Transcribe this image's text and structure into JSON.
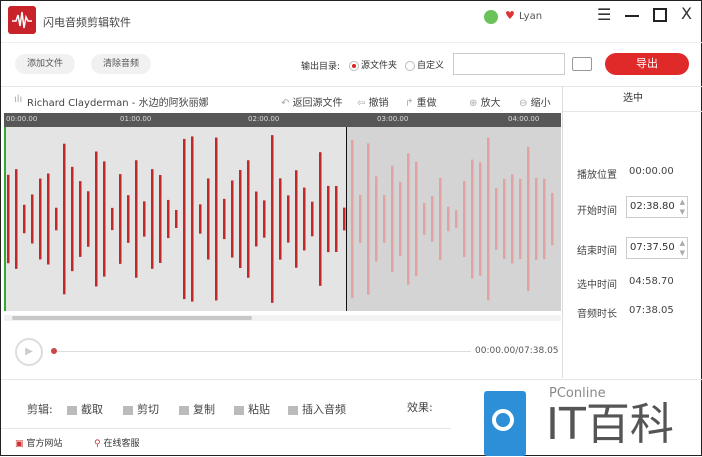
{
  "app": {
    "title": "闪电音频剪辑软件",
    "user": "Lyan"
  },
  "toolbar": {
    "add_file": "添加文件",
    "clear_audio": "清除音频",
    "output_dir_label": "输出目录:",
    "radio_source": "源文件夹",
    "radio_custom": "自定义",
    "path_value": "",
    "export": "导出"
  },
  "track": {
    "name": "Richard Clayderman - 水边的阿狄丽娜",
    "return_source": "返回源文件",
    "undo": "撤销",
    "redo": "重做",
    "zoom_in": "放大",
    "zoom_out": "缩小"
  },
  "ruler": {
    "ticks": [
      "00:00.00",
      "01:00.00",
      "02:00.00",
      "03:00.00",
      "04:00.00"
    ]
  },
  "panel": {
    "header": "选中",
    "play_pos_label": "播放位置",
    "play_pos": "00:00.00",
    "start_label": "开始时间",
    "start": "02:38.80",
    "end_label": "结束时间",
    "end": "07:37.50",
    "sel_label": "选中时间",
    "sel": "04:58.70",
    "dur_label": "音频时长",
    "dur": "07:38.05"
  },
  "player": {
    "time": "00:00.00/07:38.05",
    "progress": 0
  },
  "edit": {
    "label": "剪辑:",
    "trim": "截取",
    "cut": "剪切",
    "copy": "复制",
    "paste": "粘贴",
    "insert": "插入音频",
    "effect_label": "效果:"
  },
  "footer": {
    "website": "官方网站",
    "support": "在线客服"
  },
  "watermark": {
    "brand": "PConline",
    "name": "IT百科"
  },
  "colors": {
    "accent": "#e02a2a",
    "wave": "#c0282a",
    "wave_selected": "#e3a2a2"
  }
}
